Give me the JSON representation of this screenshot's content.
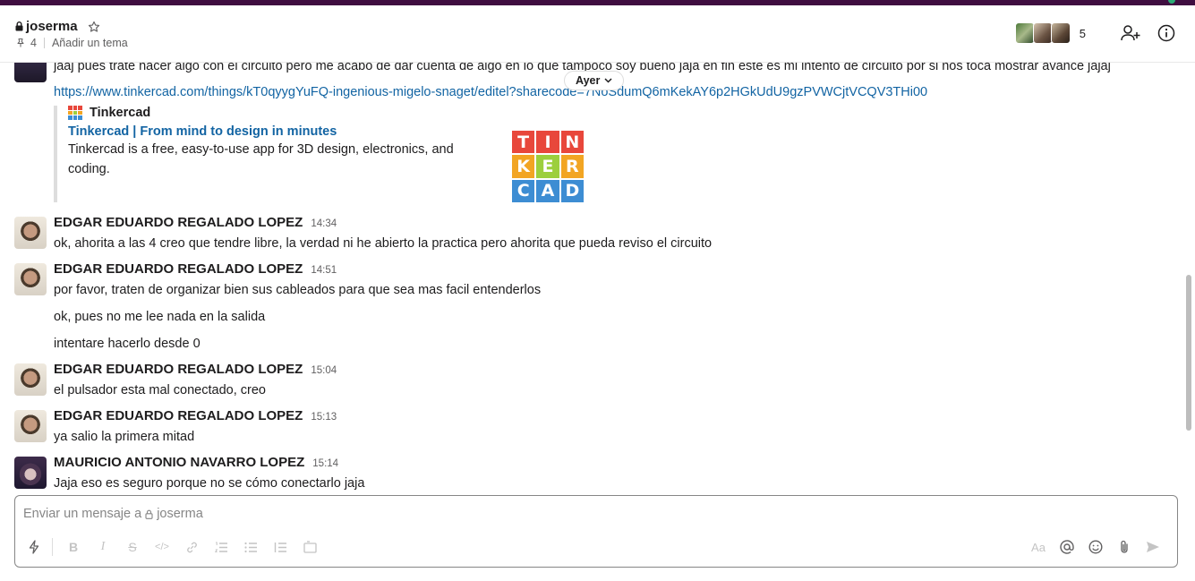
{
  "channel": {
    "name": "joserma",
    "pins_count": "4",
    "topic_placeholder": "Añadir un tema",
    "member_count": "5"
  },
  "date_divider": "Ayer",
  "messages": {
    "top_text": "jaaj pues trate hacer algo con el circuito pero me acabo de dar cuenta de algo en lo que tampoco soy bueno jaja en fin este es mi intento de circuito por si nos toca mostrar avance jajaj",
    "top_link": "https://www.tinkercad.com/things/kT0qyygYuFQ-ingenious-migelo-snaget/editel?sharecode=7NoSdumQ6mKekAY6p2HGkUdU9gzPVWCjtVCQV3THi00",
    "unfurl": {
      "source": "Tinkercad",
      "title": "Tinkercad | From mind to design in minutes",
      "description": "Tinkercad is a free, easy-to-use app for 3D design, electronics, and coding.",
      "logo_letters": [
        "T",
        "I",
        "N",
        "K",
        "E",
        "R",
        "C",
        "A",
        "D"
      ],
      "logo_colors": [
        "#e8473b",
        "#e8473b",
        "#e8473b",
        "#f2a523",
        "#9ccf3d",
        "#f2a523",
        "#3d8dd3",
        "#3d8dd3",
        "#3d8dd3"
      ]
    },
    "m1": {
      "name": "EDGAR EDUARDO REGALADO LOPEZ",
      "time": "14:34",
      "text": "ok, ahorita a las 4 creo que tendre libre, la verdad ni he abierto la practica pero ahorita que pueda reviso el circuito"
    },
    "m2": {
      "name": "EDGAR EDUARDO REGALADO LOPEZ",
      "time": "14:51",
      "text": "por favor, traten de organizar bien sus cableados para que sea mas facil entenderlos",
      "text2": "ok, pues no me lee nada en la salida",
      "text3": "intentare hacerlo desde 0"
    },
    "m3": {
      "name": "EDGAR EDUARDO REGALADO LOPEZ",
      "time": "15:04",
      "text": "el pulsador esta mal conectado, creo"
    },
    "m4": {
      "name": "EDGAR EDUARDO REGALADO LOPEZ",
      "time": "15:13",
      "text": "ya salio la primera mitad"
    },
    "m5": {
      "name": "MAURICIO ANTONIO NAVARRO LOPEZ",
      "time": "15:14",
      "text": "Jaja eso es seguro porque no se cómo conectarlo jaja"
    }
  },
  "composer": {
    "placeholder_prefix": "Enviar un mensaje a",
    "placeholder_channel": "joserma",
    "format_placeholder": "Aa"
  },
  "colors": {
    "link": "#1264a3",
    "topbar": "#3f0e40"
  }
}
